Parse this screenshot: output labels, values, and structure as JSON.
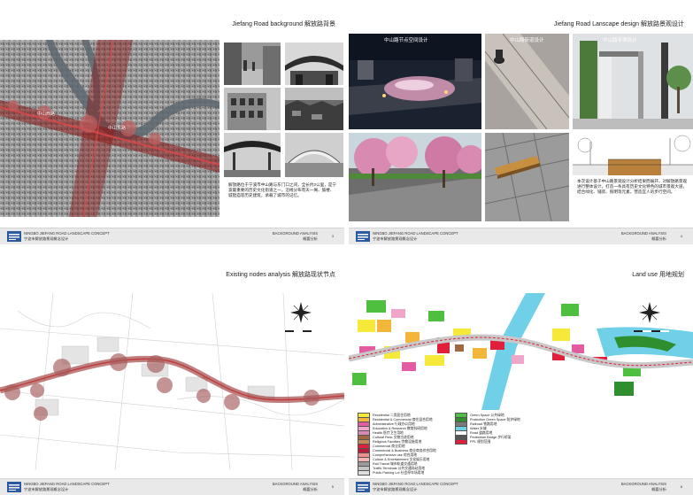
{
  "footer": {
    "title_en": "NINGBO JIEFANG ROAD LANDSCAPE CONCEPT",
    "title_cn": "宁波市解放路景观概念设计",
    "section_en": "BACKGROUND ANALYSIS",
    "section_cn": "概要分析"
  },
  "page1": {
    "title": "Jiefang Road background  解放路背景",
    "page_number": "3",
    "map_labels": [
      "中山西路",
      "中山东路"
    ],
    "description": "解放路位于宁波市中山路与东门口之间，全长约2公里，是宁波最重要的历史文化街道之一，沿线分布有天一阁、鼓楼、城隍庙等历史建筑，承载了城市的记忆。"
  },
  "page2": {
    "title": "Jiefang Road Lanscape design  解放路景观设计",
    "page_number": "4",
    "captions": [
      "中山路节点空间设计",
      "中山路街道设计",
      "中山路专项设计"
    ],
    "description": "本次设计基于中山路景观设计分析结果而展开，对解放路景观进行整体设计，打造一条具有历史文化特色的城市景观大道，结合绿化、铺装、照明等元素，营造宜人的步行空间。"
  },
  "page3": {
    "title": "Existing nodes analysis  解放路现状节点",
    "page_number": "5"
  },
  "page4": {
    "title": "Land use  用地规划",
    "page_number": "6",
    "legend": [
      {
        "label": "Residential 二类居住用地",
        "color": "#f6e93a"
      },
      {
        "label": "Residential & Commercial 商住混合用地",
        "color": "#f3b53a"
      },
      {
        "label": "Administrative 行政办公用地",
        "color": "#e35ba0"
      },
      {
        "label": "Education & Research 教育科研用地",
        "color": "#f0a6c9"
      },
      {
        "label": "Health 医疗卫生用地",
        "color": "#d98ab4"
      },
      {
        "label": "Cultural Relic 文物古迹用地",
        "color": "#a2683f"
      },
      {
        "label": "Religious Facilities 宗教设施用地",
        "color": "#c38a55"
      },
      {
        "label": "Commercial 商业用地",
        "color": "#e0203a"
      },
      {
        "label": "Commercial & Business 商业商务综合用地",
        "color": "#b51d3b"
      },
      {
        "label": "Comprehensive use 综合用地",
        "color": "#f08d8d"
      },
      {
        "label": "Culture & Entertainment 文化娱乐用地",
        "color": "#f4b2b2"
      },
      {
        "label": "Rail Transit 城市轨道交通用地",
        "color": "#9a9a9a"
      },
      {
        "label": "Traffic Terminals 公共交通场站用地",
        "color": "#c4c4c4"
      },
      {
        "label": "Public Parking Lot 社会停车场用地",
        "color": "#dedede"
      },
      {
        "label": "Green Space 公共绿地",
        "color": "#4fbf3f"
      },
      {
        "label": "Protection Green Space 防护绿地",
        "color": "#2f8f2f"
      },
      {
        "label": "Railroad 铁路用地",
        "color": "#7a7a7a"
      },
      {
        "label": "Water 水域",
        "color": "#6fd0e8"
      },
      {
        "label": "Road 道路用地",
        "color": "#ffffff"
      },
      {
        "label": "Pedestrian Bridge 步行桥梁",
        "color": "#555555"
      },
      {
        "label": "PPL 规划范围",
        "color": "#e0203a"
      }
    ]
  }
}
